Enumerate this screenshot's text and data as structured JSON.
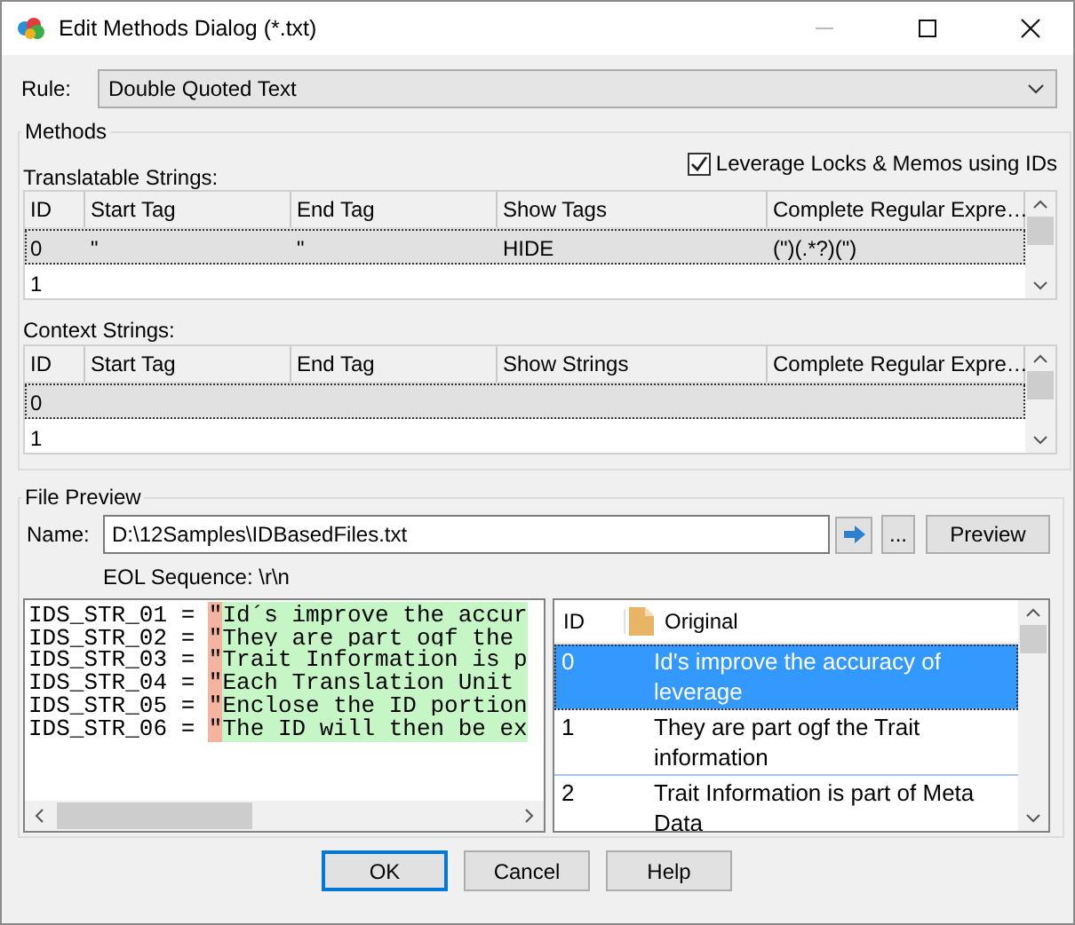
{
  "window": {
    "title": "Edit Methods Dialog (*.txt)"
  },
  "rule": {
    "label": "Rule:",
    "value": "Double Quoted Text"
  },
  "methods": {
    "title": "Methods",
    "leverage": {
      "label": "Leverage Locks & Memos using IDs",
      "checked": true
    },
    "translatable": {
      "label": "Translatable Strings:",
      "columns": [
        "ID",
        "Start Tag",
        "End Tag",
        "Show Tags",
        "Complete Regular Expre…"
      ],
      "rows": [
        {
          "cells": [
            "0",
            "\"",
            "\"",
            "HIDE",
            "(\")(.*?)(\")"
          ],
          "selected": true
        },
        {
          "cells": [
            "1"
          ],
          "selected": false
        }
      ]
    },
    "context": {
      "label": "Context Strings:",
      "columns": [
        "ID",
        "Start Tag",
        "End Tag",
        "Show Strings",
        "Complete Regular Expre…"
      ],
      "rows": [
        {
          "cells": [
            "0"
          ],
          "selected": true
        },
        {
          "cells": [
            "1"
          ],
          "selected": false
        }
      ]
    }
  },
  "preview": {
    "title": "File Preview",
    "name_label": "Name:",
    "path": "D:\\12Samples\\IDBasedFiles.txt",
    "browse": "...",
    "preview_button": "Preview",
    "eol": "EOL Sequence: \\r\\n",
    "code_lines": [
      {
        "prefix": "IDS_STR_01 = ",
        "delimiter": "\"",
        "match": "Id´s improve the accur"
      },
      {
        "prefix": "IDS_STR_02 = ",
        "delimiter": "\"",
        "match": "They are part ogf the "
      },
      {
        "prefix": "IDS_STR_03 = ",
        "delimiter": "\"",
        "match": "Trait Information is p"
      },
      {
        "prefix": "IDS_STR_04 = ",
        "delimiter": "\"",
        "match": "Each Translation Unit "
      },
      {
        "prefix": "IDS_STR_05 = ",
        "delimiter": "\"",
        "match": "Enclose the ID portion"
      },
      {
        "prefix": "IDS_STR_06 = ",
        "delimiter": "\"",
        "match": "The ID will then be ex"
      }
    ],
    "segments": {
      "columns": [
        "ID",
        "Original"
      ],
      "rows": [
        {
          "id": "0",
          "text": "Id's improve the accuracy of leverage",
          "selected": true
        },
        {
          "id": "1",
          "text": "They are part ogf the Trait information",
          "selected": false
        },
        {
          "id": "2",
          "text": "Trait Information is part of Meta Data",
          "selected": false
        }
      ]
    }
  },
  "buttons": [
    {
      "label": "OK",
      "default": true
    },
    {
      "label": "Cancel",
      "default": false
    },
    {
      "label": "Help",
      "default": false
    }
  ]
}
